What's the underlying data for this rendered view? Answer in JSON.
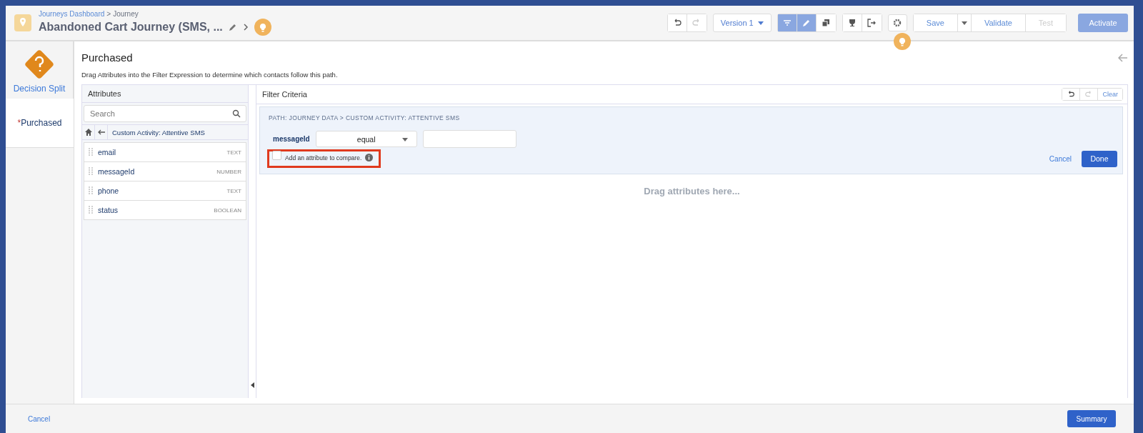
{
  "header": {
    "breadcrumb": {
      "link": "Journeys Dashboard",
      "separator": ">",
      "current": "Journey"
    },
    "title": "Abandoned Cart Journey (SMS, ...",
    "toolbar": {
      "history": [
        {
          "kind": "undo",
          "disabled": false
        },
        {
          "kind": "redo",
          "disabled": true
        }
      ],
      "version": "Version 1",
      "modes": [
        {
          "kind": "filter",
          "selected": true
        },
        {
          "kind": "pencil",
          "selected": true
        },
        {
          "kind": "copy",
          "selected": false
        }
      ],
      "actions": [
        {
          "label": "Save",
          "disabled": false
        },
        {
          "label": "Validate",
          "disabled": false
        },
        {
          "label": "Test",
          "disabled": true
        }
      ],
      "activate": "Activate"
    }
  },
  "sidebar": {
    "activity": "Decision Split",
    "paths": [
      {
        "marker": "*",
        "label": "Purchased",
        "selected": true
      }
    ]
  },
  "main": {
    "title": "Purchased",
    "description": "Drag Attributes into the Filter Expression to determine which contacts follow this path.",
    "attributes": {
      "title": "Attributes",
      "search": {
        "placeholder": "Search"
      },
      "location": "Custom Activity: Attentive SMS",
      "items": [
        {
          "name": "email",
          "type": "TEXT"
        },
        {
          "name": "messageId",
          "type": "NUMBER"
        },
        {
          "name": "phone",
          "type": "TEXT"
        },
        {
          "name": "status",
          "type": "BOOLEAN"
        }
      ]
    },
    "filter": {
      "title": "Filter Criteria",
      "clear": "Clear",
      "path": "PATH: JOURNEY DATA > CUSTOM ACTIVITY: ATTENTIVE SMS",
      "field": "messageId",
      "operator": "equal",
      "compare": {
        "label": "Add an attribute to compare.",
        "checked": false,
        "highlighted": true
      },
      "cancel": "Cancel",
      "done": "Done",
      "drop_hint": "Drag attributes here..."
    }
  },
  "footer": {
    "cancel": "Cancel",
    "summary": "Summary"
  }
}
